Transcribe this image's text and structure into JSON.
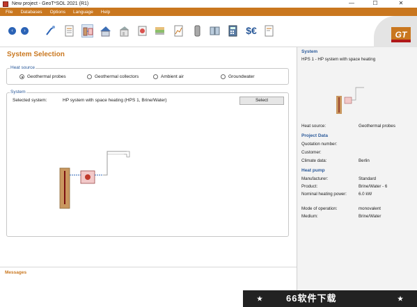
{
  "window": {
    "title": "New project - GeoT*SOL 2021 (R1)",
    "minimize": "—",
    "maximize": "☐",
    "close": "✕"
  },
  "menu": [
    "File",
    "Databases",
    "Options",
    "Language",
    "Help"
  ],
  "toolbar": {
    "back": "‹",
    "forward": "›",
    "buttons": [
      "probe-icon",
      "document-icon",
      "system-selection-icon",
      "house-icon",
      "building-icon",
      "heatpump-icon",
      "heat-source-icon",
      "chart-icon",
      "hot-water-icon",
      "panels-icon",
      "calculator-icon",
      "dollar-euro-icon",
      "report-icon"
    ],
    "dollar_euro": "$€",
    "logo": "GT"
  },
  "main": {
    "title": "System Selection",
    "heat_source": {
      "legend": "Heat source",
      "options": [
        {
          "label": "Geothermal probes",
          "selected": true
        },
        {
          "label": "Geothermal collectors",
          "selected": false
        },
        {
          "label": "Ambient air",
          "selected": false
        },
        {
          "label": "Groundwater",
          "selected": false
        }
      ]
    },
    "system": {
      "legend": "System",
      "selected_label": "Selected system:",
      "selected_value": "HP system with space heating (HPS 1, Brine/Water)",
      "select_button": "Select"
    }
  },
  "messages": {
    "title": "Messages"
  },
  "right_panel": {
    "system_heading": "System",
    "system_name": "HPS 1 - HP system with space heating",
    "heat_source_label": "Heat source:",
    "heat_source_value": "Geothermal probes",
    "project_heading": "Project Data",
    "quotation_label": "Quotation number:",
    "customer_label": "Customer:",
    "climate_label": "Climate data:",
    "climate_value": "Berlin",
    "heatpump_heading": "Heat pump",
    "manufacturer_label": "Manufacturer:",
    "manufacturer_value": "Standard",
    "product_label": "Product:",
    "product_value": "Brine/Water -  6",
    "power_label": "Nominal heating power:",
    "power_value": "6.0 kW",
    "mode_label": "Mode of operation:",
    "mode_value": "monovalent",
    "medium_label": "Medium:",
    "medium_value": "Brine/Water"
  },
  "banner": {
    "text": "66软件下载",
    "star": "★"
  },
  "colors": {
    "accent_orange": "#c9771f",
    "heading_blue": "#2b5a9a",
    "nav_blue": "#2b63b6",
    "logo_red": "#b01818"
  }
}
